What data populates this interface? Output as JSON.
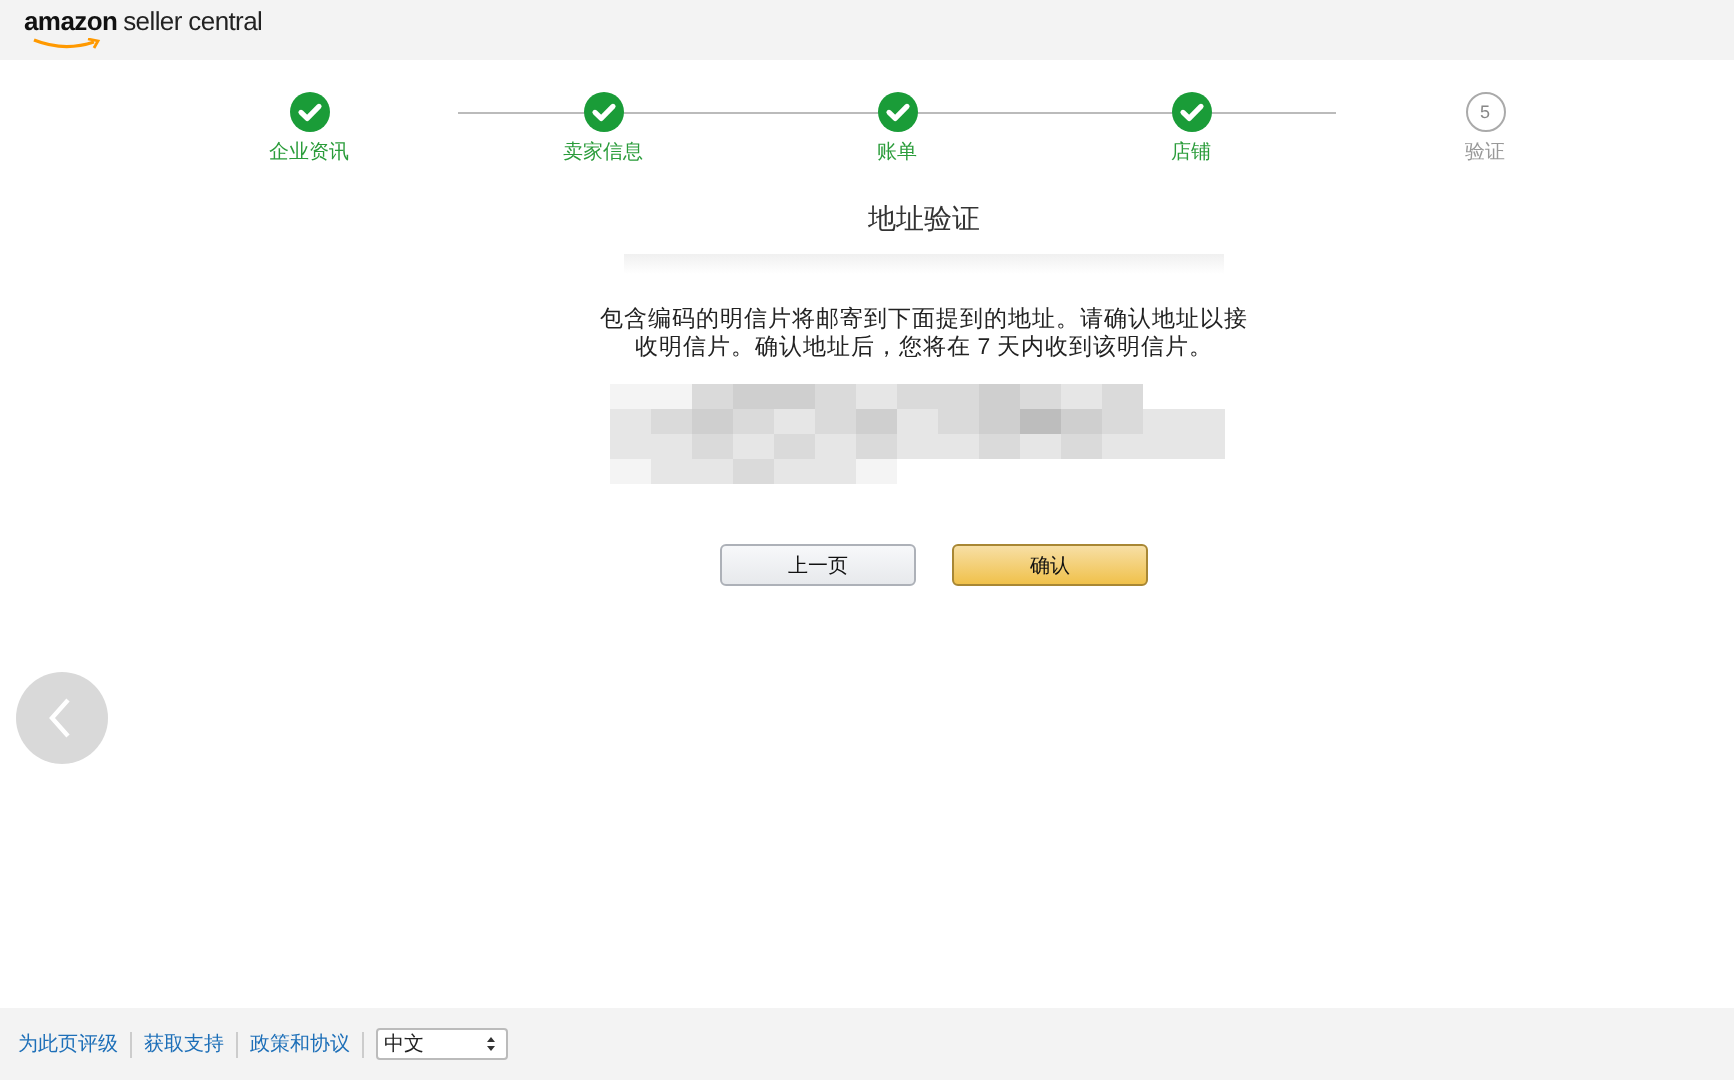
{
  "header": {
    "logo_brand": "amazon",
    "logo_product": "seller central"
  },
  "steps": [
    {
      "label": "企业资讯",
      "completed": true
    },
    {
      "label": "卖家信息",
      "completed": true
    },
    {
      "label": "账单",
      "completed": true
    },
    {
      "label": "店铺",
      "completed": true
    },
    {
      "label": "验证",
      "number": "5",
      "completed": false
    }
  ],
  "main": {
    "title": "地址验证",
    "message": "包含编码的明信片将邮寄到下面提到的地址。请确认地址以接收明信片。确认地址后，您将在 7 天内收到该明信片。",
    "buttons": [
      {
        "label": "上一页",
        "kind": "secondary"
      },
      {
        "label": "确认",
        "kind": "primary"
      }
    ]
  },
  "footer": {
    "links": [
      "为此页评级",
      "获取支持",
      "政策和协议"
    ],
    "language": {
      "value": "中文"
    }
  }
}
